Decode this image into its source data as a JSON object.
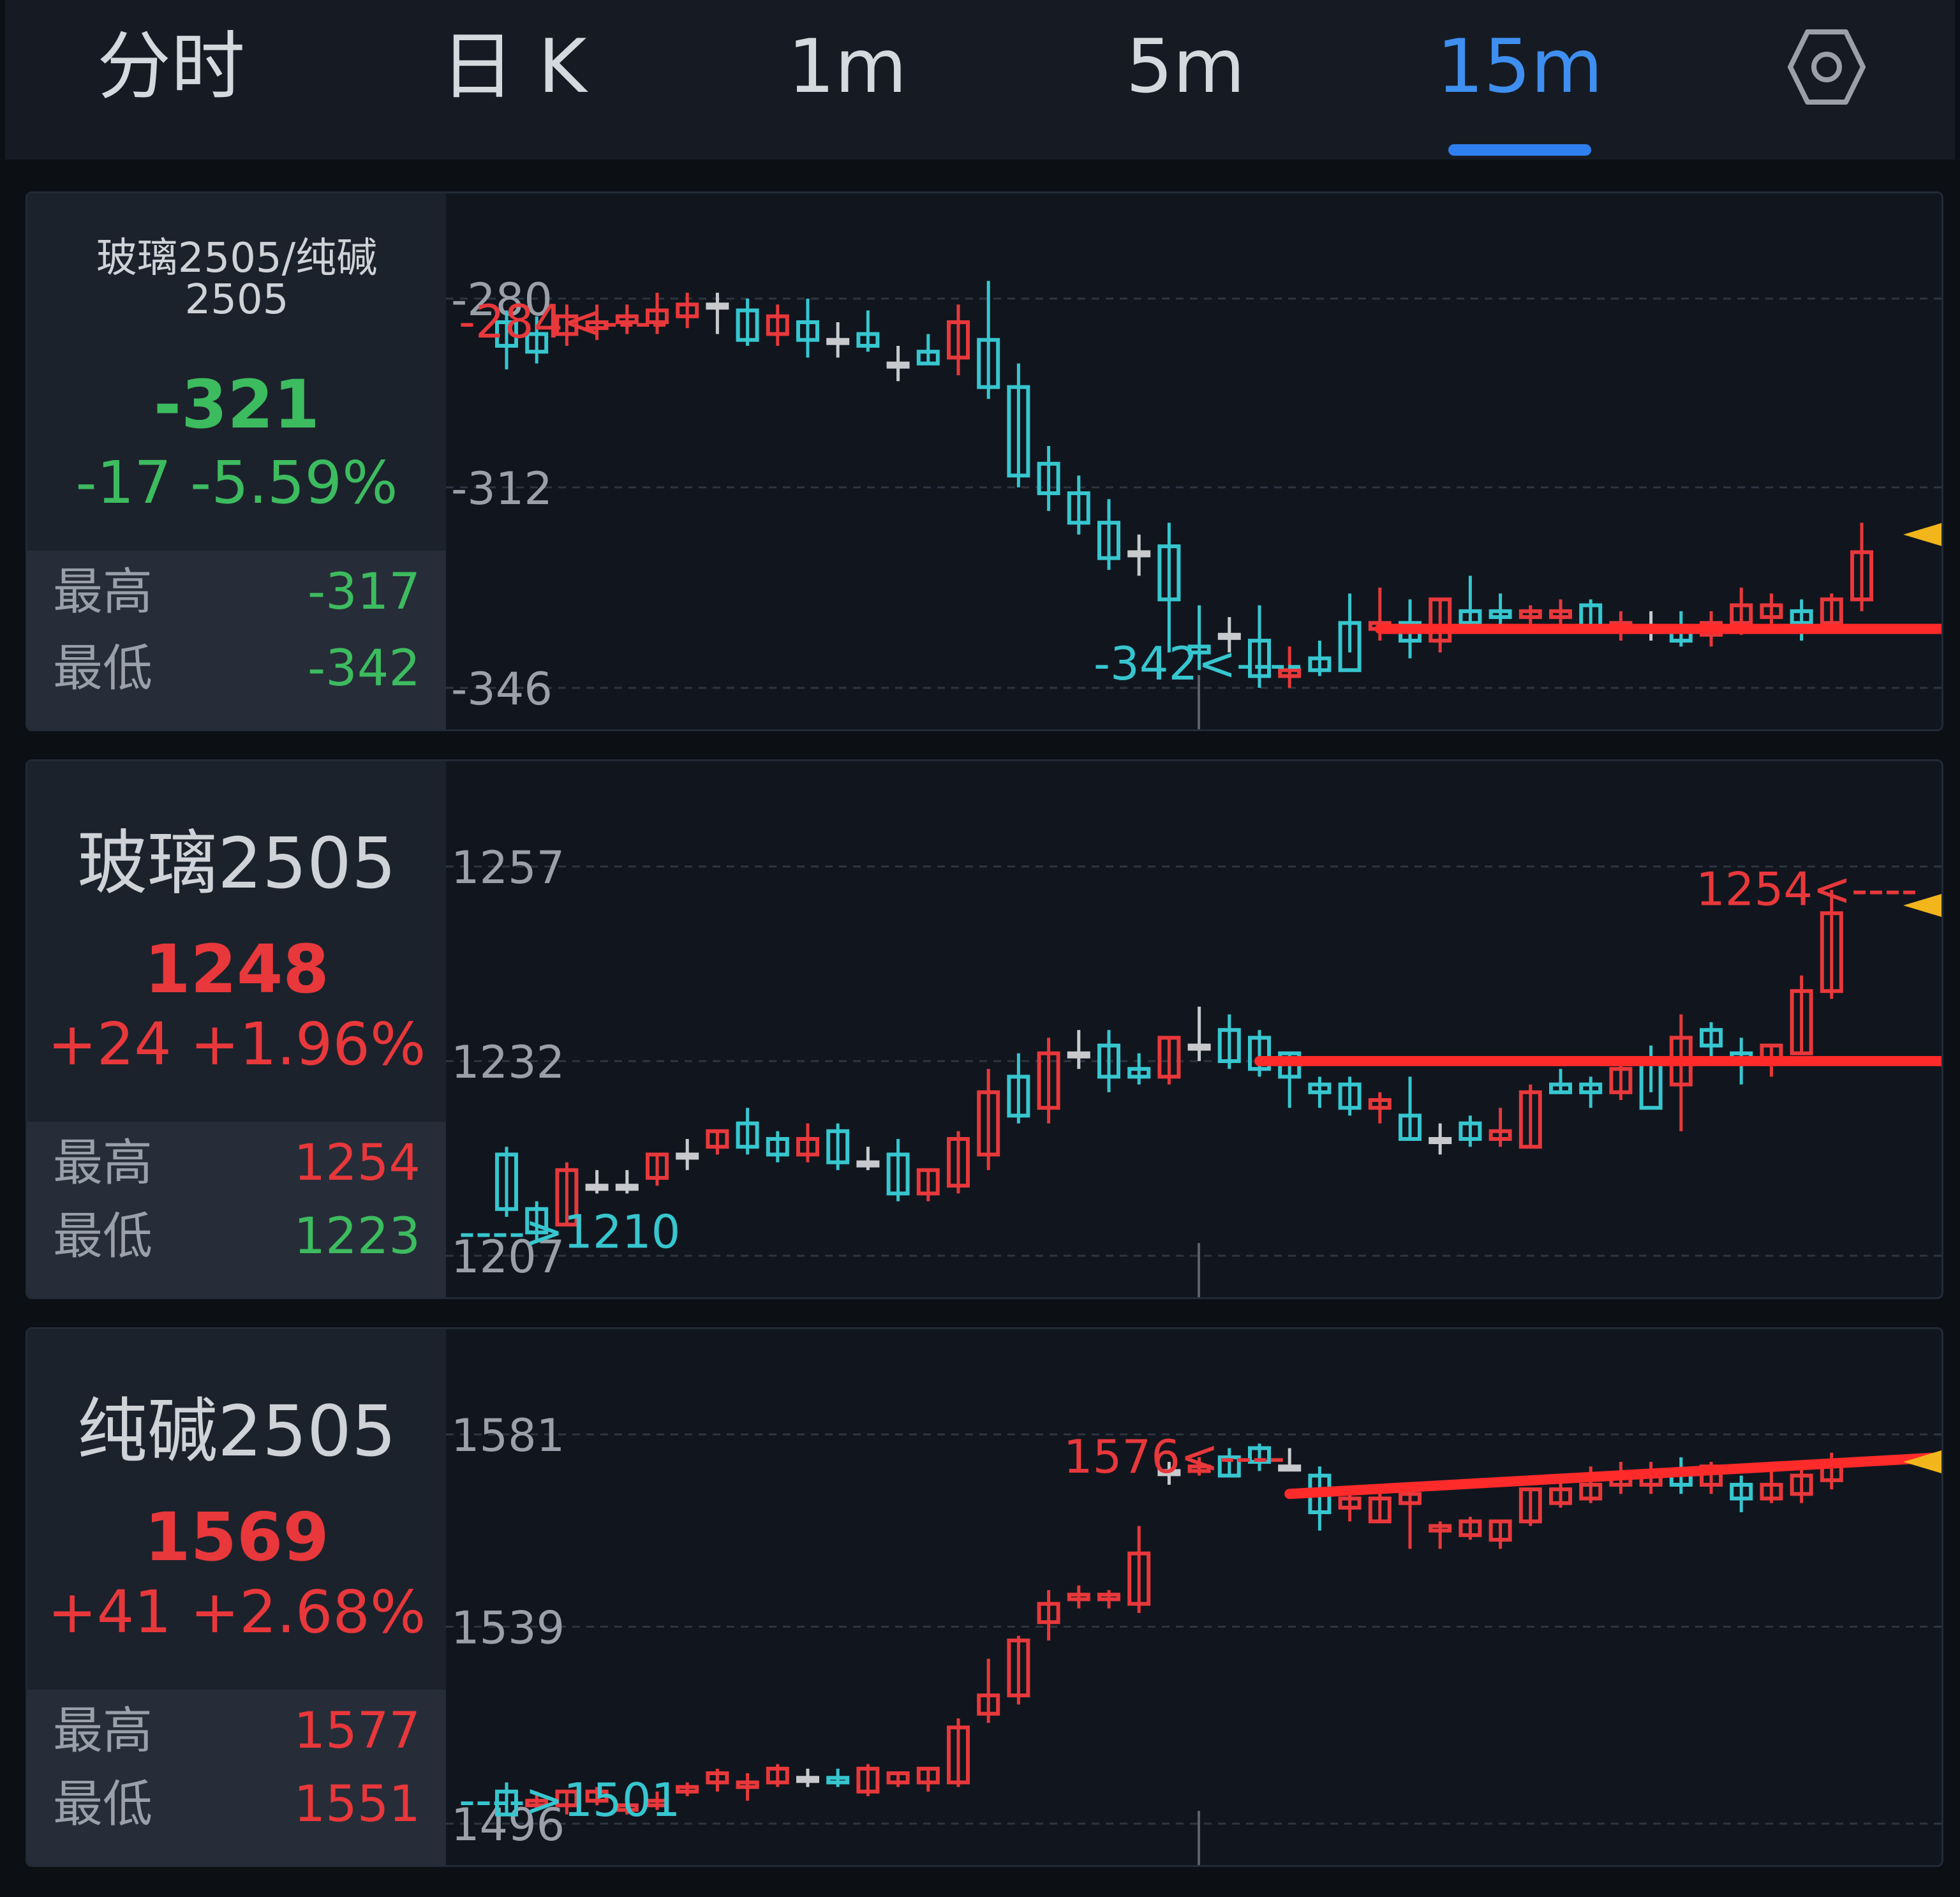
{
  "tabs": [
    {
      "label": "分时",
      "active": false
    },
    {
      "label": "日 K",
      "active": false
    },
    {
      "label": "1m",
      "active": false
    },
    {
      "label": "5m",
      "active": false
    },
    {
      "label": "15m",
      "active": true
    }
  ],
  "settings_icon": "hexagon-gear-icon",
  "colors": {
    "up": "#e8383b",
    "down": "#3dbb5f",
    "candle_down": "#37c6cf",
    "neutral": "#c7c9cc",
    "accent": "#2f7ff0",
    "marker": "#f2b51c"
  },
  "panels": [
    {
      "title_line1": "玻璃2505/纯碱",
      "title_line2": "2505",
      "price": "-321",
      "change": "-17 -5.59%",
      "trend": "down",
      "high_label": "最高",
      "high": "-317",
      "low_label": "最低",
      "low": "-342"
    },
    {
      "title_line1": "玻璃2505",
      "price": "1248",
      "change": "+24 +1.96%",
      "trend": "up",
      "high_label": "最高",
      "high": "1254",
      "low_label": "最低",
      "low": "1223"
    },
    {
      "title_line1": "纯碱2505",
      "price": "1569",
      "change": "+41 +2.68%",
      "trend": "up",
      "high_label": "最高",
      "high": "1577",
      "low_label": "最低",
      "low": "1551"
    }
  ],
  "chart_data": [
    {
      "type": "candlestick",
      "title": "玻璃2505/纯碱2505",
      "y_ticks": [
        -280,
        -312,
        -346
      ],
      "ylim": [
        -346,
        -280
      ],
      "grid": true,
      "annotations": [
        {
          "text": "-284<----",
          "x": 1,
          "y": -284,
          "color": "up"
        },
        {
          "text": "-342<----",
          "x": 25,
          "y": -342,
          "color": "candle_down"
        }
      ],
      "trend_line": {
        "x": [
          29,
          49
        ],
        "y": [
          -336,
          -336
        ]
      },
      "last_marker": -320,
      "ohlc": [
        [
          -284,
          -282,
          -292,
          -288
        ],
        [
          -286,
          -283,
          -291,
          -289
        ],
        [
          -286,
          -281,
          -288,
          -283
        ],
        [
          -285,
          -281,
          -287,
          -284
        ],
        [
          -284,
          -281,
          -286,
          -283
        ],
        [
          -284,
          -279,
          -286,
          -282
        ],
        [
          -283,
          -279,
          -285,
          -281
        ],
        [
          -281,
          -279,
          -286,
          -281
        ],
        [
          -282,
          -280,
          -288,
          -287
        ],
        [
          -286,
          -281,
          -288,
          -283
        ],
        [
          -284,
          -280,
          -290,
          -287
        ],
        [
          -287,
          -284,
          -290,
          -287
        ],
        [
          -286,
          -282,
          -289,
          -288
        ],
        [
          -291,
          -288,
          -294,
          -291
        ],
        [
          -289,
          -286,
          -291,
          -291
        ],
        [
          -290,
          -281,
          -293,
          -284
        ],
        [
          -287,
          -277,
          -297,
          -295
        ],
        [
          -295,
          -291,
          -312,
          -310
        ],
        [
          -308,
          -305,
          -316,
          -313
        ],
        [
          -313,
          -310,
          -320,
          -318
        ],
        [
          -318,
          -314,
          -326,
          -324
        ],
        [
          -323,
          -320,
          -327,
          -323
        ],
        [
          -322,
          -318,
          -340,
          -331
        ],
        [
          -339,
          -332,
          -343,
          -340
        ],
        [
          -337,
          -334,
          -340,
          -337
        ],
        [
          -338,
          -332,
          -346,
          -344
        ],
        [
          -344,
          -339,
          -346,
          -343
        ],
        [
          -341,
          -338,
          -344,
          -343
        ],
        [
          -335,
          -330,
          -340,
          -343
        ],
        [
          -336,
          -329,
          -338,
          -335
        ],
        [
          -335,
          -331,
          -341,
          -338
        ],
        [
          -338,
          -331,
          -340,
          -331
        ],
        [
          -333,
          -327,
          -336,
          -335
        ],
        [
          -333,
          -330,
          -336,
          -334
        ],
        [
          -334,
          -332,
          -336,
          -333
        ],
        [
          -334,
          -331,
          -336,
          -333
        ],
        [
          -332,
          -331,
          -336,
          -336
        ],
        [
          -336,
          -333,
          -338,
          -335
        ],
        [
          -336,
          -333,
          -338,
          -336
        ],
        [
          -336,
          -333,
          -339,
          -338
        ],
        [
          -337,
          -333,
          -339,
          -335
        ],
        [
          -335,
          -329,
          -337,
          -332
        ],
        [
          -334,
          -330,
          -336,
          -332
        ],
        [
          -333,
          -331,
          -338,
          -335
        ],
        [
          -335,
          -330,
          -336,
          -331
        ],
        [
          -331,
          -318,
          -333,
          -323
        ]
      ]
    },
    {
      "type": "candlestick",
      "title": "玻璃2505",
      "y_ticks": [
        1257,
        1232,
        1207
      ],
      "ylim": [
        1207,
        1257
      ],
      "grid": true,
      "annotations": [
        {
          "text": "1254<----",
          "x": 45,
          "y": 1254,
          "color": "up"
        },
        {
          "text": "---->1210",
          "x": 1,
          "y": 1210,
          "color": "candle_down"
        }
      ],
      "trend_line": {
        "x": [
          25,
          49
        ],
        "y": [
          1232,
          1232
        ]
      },
      "last_marker": 1252,
      "ohlc": [
        [
          1220,
          1221,
          1212,
          1213
        ],
        [
          1213,
          1214,
          1209,
          1210
        ],
        [
          1211,
          1219,
          1211,
          1218
        ],
        [
          1216,
          1218,
          1215,
          1216
        ],
        [
          1216,
          1218,
          1215,
          1216
        ],
        [
          1217,
          1220,
          1216,
          1220
        ],
        [
          1220,
          1222,
          1218,
          1220
        ],
        [
          1221,
          1223,
          1220,
          1223
        ],
        [
          1224,
          1226,
          1220,
          1221
        ],
        [
          1222,
          1223,
          1219,
          1220
        ],
        [
          1220,
          1224,
          1219,
          1222
        ],
        [
          1223,
          1224,
          1218,
          1219
        ],
        [
          1219,
          1221,
          1218,
          1219
        ],
        [
          1220,
          1222,
          1214,
          1215
        ],
        [
          1215,
          1218,
          1214,
          1218
        ],
        [
          1216,
          1223,
          1215,
          1222
        ],
        [
          1220,
          1231,
          1218,
          1228
        ],
        [
          1230,
          1233,
          1224,
          1225
        ],
        [
          1226,
          1235,
          1224,
          1233
        ],
        [
          1233,
          1236,
          1231,
          1233
        ],
        [
          1234,
          1236,
          1228,
          1230
        ],
        [
          1231,
          1233,
          1229,
          1230
        ],
        [
          1230,
          1235,
          1229,
          1235
        ],
        [
          1234,
          1239,
          1232,
          1234
        ],
        [
          1236,
          1238,
          1231,
          1232
        ],
        [
          1235,
          1236,
          1230,
          1231
        ],
        [
          1233,
          1233,
          1226,
          1230
        ],
        [
          1229,
          1230,
          1226,
          1228
        ],
        [
          1229,
          1230,
          1225,
          1226
        ],
        [
          1226,
          1228,
          1224,
          1227
        ],
        [
          1225,
          1230,
          1222,
          1222
        ],
        [
          1222,
          1224,
          1220,
          1222
        ],
        [
          1224,
          1225,
          1221,
          1222
        ],
        [
          1222,
          1226,
          1221,
          1223
        ],
        [
          1221,
          1229,
          1221,
          1228
        ],
        [
          1229,
          1231,
          1228,
          1228
        ],
        [
          1229,
          1230,
          1226,
          1228
        ],
        [
          1228,
          1232,
          1227,
          1231
        ],
        [
          1232,
          1234,
          1228,
          1226
        ],
        [
          1229,
          1238,
          1223,
          1235
        ],
        [
          1236,
          1237,
          1232,
          1234
        ],
        [
          1233,
          1235,
          1229,
          1232
        ],
        [
          1232,
          1234,
          1230,
          1234
        ],
        [
          1233,
          1243,
          1233,
          1241
        ],
        [
          1241,
          1254,
          1240,
          1251
        ]
      ]
    },
    {
      "type": "candlestick",
      "title": "纯碱2505",
      "y_ticks": [
        1581,
        1539,
        1496
      ],
      "ylim": [
        1496,
        1581
      ],
      "grid": true,
      "annotations": [
        {
          "text": "1576<----",
          "x": 24,
          "y": 1576,
          "color": "up"
        },
        {
          "text": "---->1501",
          "x": 1,
          "y": 1501,
          "color": "candle_down"
        }
      ],
      "trend_line": {
        "x": [
          26,
          49
        ],
        "y": [
          1568,
          1576
        ]
      },
      "last_marker": 1575,
      "ohlc": [
        [
          1503,
          1505,
          1498,
          1498
        ],
        [
          1500,
          1503,
          1499,
          1501
        ],
        [
          1500,
          1503,
          1498,
          1503
        ],
        [
          1501,
          1504,
          1500,
          1503
        ],
        [
          1499,
          1503,
          1498,
          1500
        ],
        [
          1500,
          1503,
          1499,
          1501
        ],
        [
          1503,
          1505,
          1502,
          1504
        ],
        [
          1505,
          1508,
          1503,
          1507
        ],
        [
          1504,
          1507,
          1501,
          1505
        ],
        [
          1505,
          1509,
          1504,
          1508
        ],
        [
          1506,
          1508,
          1504,
          1506
        ],
        [
          1506,
          1508,
          1504,
          1505
        ],
        [
          1503,
          1509,
          1502,
          1508
        ],
        [
          1505,
          1507,
          1504,
          1507
        ],
        [
          1505,
          1508,
          1503,
          1508
        ],
        [
          1505,
          1519,
          1504,
          1517
        ],
        [
          1520,
          1532,
          1518,
          1524
        ],
        [
          1524,
          1537,
          1522,
          1536
        ],
        [
          1540,
          1547,
          1536,
          1544
        ],
        [
          1545,
          1548,
          1543,
          1546
        ],
        [
          1545,
          1547,
          1543,
          1546
        ],
        [
          1544,
          1561,
          1542,
          1555
        ],
        [
          1573,
          1575,
          1570,
          1573
        ],
        [
          1573,
          1576,
          1572,
          1574
        ],
        [
          1576,
          1578,
          1572,
          1572
        ],
        [
          1578,
          1579,
          1573,
          1575
        ],
        [
          1574,
          1578,
          1573,
          1574
        ],
        [
          1572,
          1574,
          1560,
          1564
        ],
        [
          1565,
          1568,
          1562,
          1567
        ],
        [
          1562,
          1570,
          1562,
          1567
        ],
        [
          1566,
          1568,
          1556,
          1568
        ],
        [
          1560,
          1562,
          1556,
          1561
        ],
        [
          1559,
          1563,
          1558,
          1562
        ],
        [
          1558,
          1562,
          1556,
          1562
        ],
        [
          1562,
          1569,
          1561,
          1569
        ],
        [
          1566,
          1572,
          1565,
          1569
        ],
        [
          1567,
          1574,
          1566,
          1570
        ],
        [
          1570,
          1575,
          1568,
          1572
        ],
        [
          1570,
          1575,
          1568,
          1573
        ],
        [
          1573,
          1576,
          1568,
          1570
        ],
        [
          1570,
          1575,
          1568,
          1574
        ],
        [
          1570,
          1572,
          1564,
          1567
        ],
        [
          1567,
          1573,
          1566,
          1570
        ],
        [
          1568,
          1574,
          1566,
          1572
        ],
        [
          1571,
          1577,
          1569,
          1575
        ]
      ]
    }
  ]
}
